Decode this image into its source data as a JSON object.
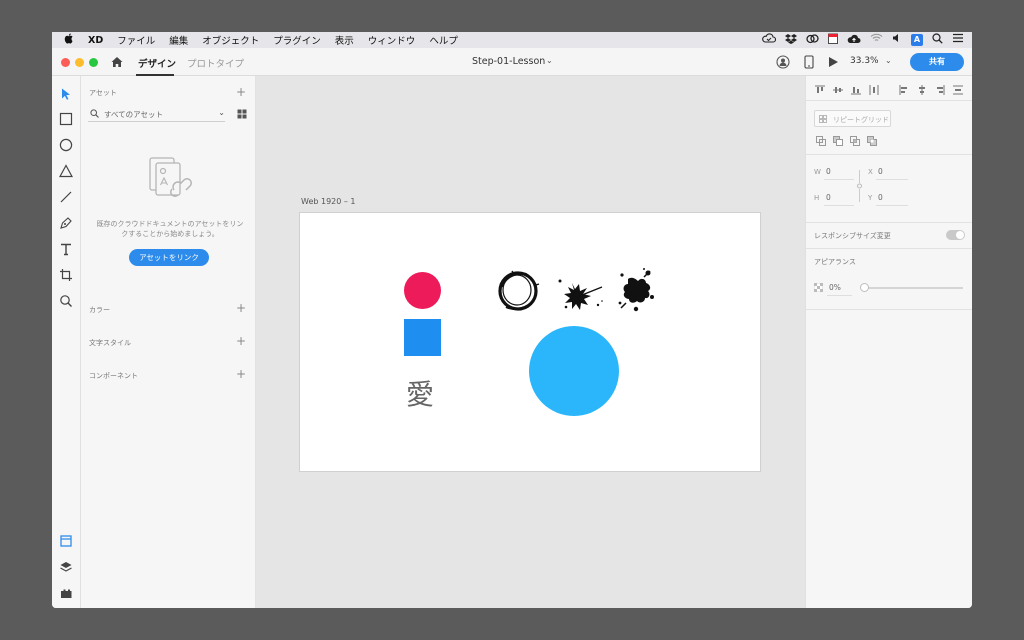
{
  "menubar": {
    "app": "XD",
    "items": [
      "ファイル",
      "編集",
      "オブジェクト",
      "プラグイン",
      "表示",
      "ウィンドウ",
      "ヘルプ"
    ],
    "status_icons": [
      "creative-cloud-sync-icon",
      "dropbox-icon",
      "creative-cloud-icon",
      "calendar-icon",
      "cloud-upload-icon",
      "wifi-icon",
      "volume-icon",
      "input-method-icon",
      "spotlight-search-icon",
      "control-center-icon"
    ],
    "input_method_letter": "A"
  },
  "titlebar": {
    "tabs": {
      "design": "デザイン",
      "prototype": "プロトタイプ"
    },
    "document_title": "Step-01-Lesson",
    "zoom": "33.3%",
    "share_label": "共有"
  },
  "assets": {
    "title": "アセット",
    "search_placeholder": "すべてのアセット",
    "empty_message": "既存のクラウドドキュメントのアセットをリンクすることから始めましょう。",
    "link_button": "アセットをリンク",
    "sections": [
      "カラー",
      "文字スタイル",
      "コンポーネント"
    ]
  },
  "canvas": {
    "artboard_name": "Web 1920 – 1",
    "kanji": "愛",
    "colors": {
      "pink": "#ee1b5b",
      "blue": "#1e8ff0",
      "cyan": "#2bb6fb"
    }
  },
  "properties": {
    "repeat_grid": "リピートグリッド",
    "w_label": "W",
    "w_value": "0",
    "h_label": "H",
    "h_value": "0",
    "x_label": "X",
    "x_value": "0",
    "y_label": "Y",
    "y_value": "0",
    "responsive_label": "レスポンシブサイズ変更",
    "responsive_enabled": true,
    "appearance_label": "アピアランス",
    "opacity_value": "0%",
    "opacity_level": 0
  },
  "accent_color": "#2d8ceb"
}
